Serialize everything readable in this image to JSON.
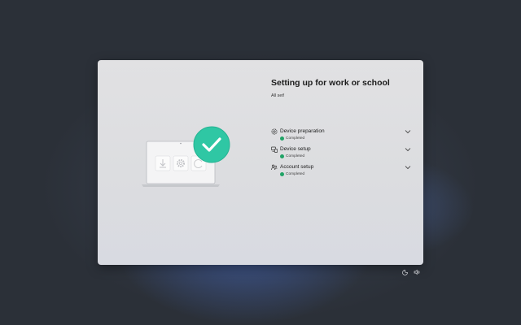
{
  "window": {
    "title": "Setting up for work or school",
    "subtitle": "All set!"
  },
  "steps": [
    {
      "label": "Device preparation",
      "status": "Completed",
      "icon": "shield-settings-icon"
    },
    {
      "label": "Device setup",
      "status": "Completed",
      "icon": "devices-icon"
    },
    {
      "label": "Account setup",
      "status": "Completed",
      "icon": "people-icon"
    }
  ],
  "illustration": {
    "icons": [
      "download-icon",
      "gear-icon",
      "refresh-icon",
      "checkmark-icon"
    ],
    "accent": "#2fc7a4"
  },
  "tray": {
    "icons": [
      "accessibility-icon",
      "volume-icon"
    ]
  },
  "colors": {
    "status_complete": "#21a366",
    "card_background": "#dedfe2"
  }
}
